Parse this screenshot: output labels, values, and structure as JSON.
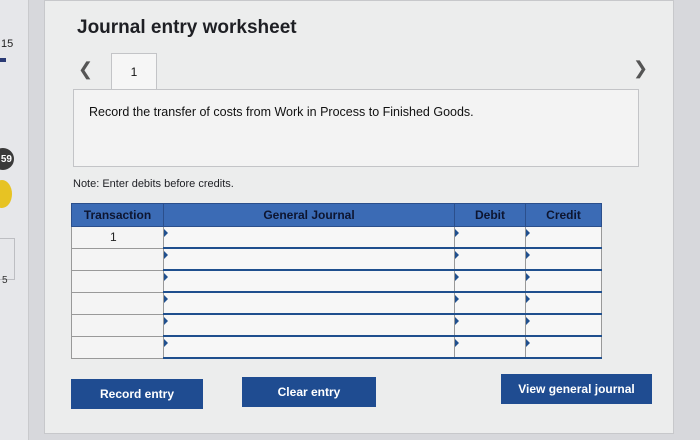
{
  "left_strip": {
    "number_top": "15",
    "badge": "59",
    "small_char": "5"
  },
  "worksheet": {
    "title": "Journal entry worksheet",
    "tab_label": "1",
    "nav_prev_icon": "chevron-left-icon",
    "nav_next_icon": "chevron-right-icon",
    "description": "Record the transfer of costs from Work in Process to Finished Goods.",
    "note": "Note: Enter debits before credits."
  },
  "table": {
    "headers": [
      "Transaction",
      "General Journal",
      "Debit",
      "Credit"
    ],
    "rows": [
      {
        "transaction": "1",
        "general_journal": "",
        "debit": "",
        "credit": ""
      },
      {
        "transaction": "",
        "general_journal": "",
        "debit": "",
        "credit": ""
      },
      {
        "transaction": "",
        "general_journal": "",
        "debit": "",
        "credit": ""
      },
      {
        "transaction": "",
        "general_journal": "",
        "debit": "",
        "credit": ""
      },
      {
        "transaction": "",
        "general_journal": "",
        "debit": "",
        "credit": ""
      },
      {
        "transaction": "",
        "general_journal": "",
        "debit": "",
        "credit": ""
      }
    ]
  },
  "buttons": {
    "record": "Record entry",
    "clear": "Clear entry",
    "view": "View general journal"
  },
  "colors": {
    "header_blue": "#3b6bb5",
    "button_blue": "#1f4c91",
    "badge_yellow": "#e7c323"
  }
}
